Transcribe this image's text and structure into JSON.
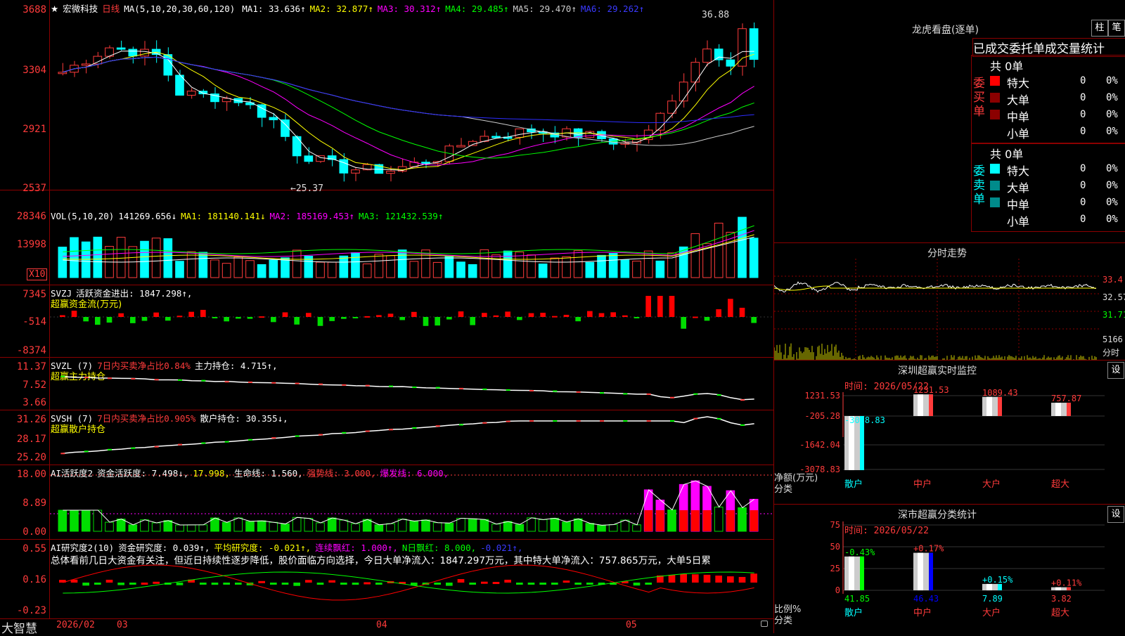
{
  "stock": {
    "name": "宏微科技",
    "period": "日线",
    "star": "★"
  },
  "main": {
    "ma_label": "MA(5,10,20,30,60,120)",
    "mas": [
      {
        "label": "MA1: 33.636↑",
        "color": "#ffffff"
      },
      {
        "label": "MA2: 32.877↑",
        "color": "#ffff00"
      },
      {
        "label": "MA3: 30.312↑",
        "color": "#ff00ff"
      },
      {
        "label": "MA4: 29.485↑",
        "color": "#00ff00"
      },
      {
        "label": "MA5: 29.470↑",
        "color": "#cccccc"
      },
      {
        "label": "MA6: 29.262↑",
        "color": "#2d2dff"
      }
    ],
    "yticks": [
      "3688",
      "3304",
      "2921",
      "2537"
    ],
    "high_label": "36.88",
    "low_label": "←25.37"
  },
  "vol": {
    "name": "VOL(5,10,20)",
    "value": "141269.656↓",
    "ma1": "MA1: 181140.141↓",
    "ma2": "MA2: 185169.453↑",
    "ma3": "MA3: 121432.539↑",
    "yticks": [
      "28346",
      "13998"
    ],
    "unit": "X10"
  },
  "svzj": {
    "name": "SVZJ",
    "t1": "活跃资金进出: 1847.298↑,",
    "t2": "超赢资金流(万元)",
    "yticks": [
      "7345",
      "-514",
      "-8374"
    ]
  },
  "svzl": {
    "name": "SVZL (7)",
    "t1": "7日内买卖净占比0.84%",
    "t2": "主力持仓: 4.715↑,",
    "t3": "超赢主力持仓",
    "yticks": [
      "11.37",
      "7.52",
      "3.66"
    ]
  },
  "svsh": {
    "name": "SVSH (7)",
    "t1": "7日内买卖净占比0.905%",
    "t2": "散户持仓: 30.355↓,",
    "t3": "超赢散户持仓",
    "yticks": [
      "31.26",
      "28.17",
      "25.20"
    ]
  },
  "ai1": {
    "name": "AI活跃度2",
    "t1": "资金活跃度: 7.498↓,",
    "t2": "17.998,",
    "t3": "生命线: 1.560,",
    "t4": "强势线: 3.000,",
    "t5": "爆发线: 6.000,",
    "yticks": [
      "18.00",
      "8.89",
      "0.00"
    ]
  },
  "ai2": {
    "name": "AI研究度2(10)",
    "t1": "资金研究度: 0.039↑,",
    "t2": "平均研究度: -0.021↑,",
    "t3": "连续飘红: 1.000↑,",
    "t4": "N日飘红: 8.000,",
    "t5": "-0.021↑,",
    "comment": "总体看前几日大资金有关注，但近日持续性逐步降低，股价面临方向选择，今日大单净流入：1847.297万元，其中特大单净流入：757.865万元，大单5日累",
    "yticks": [
      "0.55",
      "0.16",
      "-0.23"
    ]
  },
  "footer": {
    "brand": "大智慧",
    "dates": [
      "2026/02",
      "03",
      "04",
      "05"
    ]
  },
  "lhb": {
    "title": "龙虎看盘(逐单)",
    "btn1": "柱",
    "btn2": "笔",
    "tabs": "已成交委托单成交量统计",
    "buy": {
      "side": "委买单",
      "total": "共 0单",
      "rows": [
        {
          "name": "特大",
          "v": "0",
          "p": "0%",
          "c": "#ff0000"
        },
        {
          "name": "大单",
          "v": "0",
          "p": "0%",
          "c": "#8b0000"
        },
        {
          "name": "中单",
          "v": "0",
          "p": "0%",
          "c": "#8b0000"
        },
        {
          "name": "小单",
          "v": "0",
          "p": "0%",
          "c": "#000000"
        }
      ]
    },
    "sell": {
      "side": "委卖单",
      "total": "共 0单",
      "rows": [
        {
          "name": "特大",
          "v": "0",
          "p": "0%",
          "c": "#00ffff"
        },
        {
          "name": "大单",
          "v": "0",
          "p": "0%",
          "c": "#008b8b"
        },
        {
          "name": "中单",
          "v": "0",
          "p": "0%",
          "c": "#008b8b"
        },
        {
          "name": "小单",
          "v": "0",
          "p": "0%",
          "c": "#000000"
        }
      ]
    }
  },
  "intraday": {
    "title": "分时走势",
    "yticks": [
      "33.4",
      "32.57",
      "31.71"
    ],
    "vol_tick": "5166",
    "vol_label": "分时"
  },
  "sz_monitor": {
    "title": "深圳超赢实时监控",
    "btn": "设",
    "time": "时间: 2026/05/22",
    "yticks": [
      "1231.53",
      "-205.28",
      "-1642.04",
      "-3078.83"
    ],
    "ylabel": "净额(万元)",
    "xlabel": "分类",
    "bars": [
      {
        "cat": "散户",
        "value": -3078.83,
        "label": "-3078.83",
        "color": "#00ffff"
      },
      {
        "cat": "中户",
        "value": 1231.53,
        "label": "1231.53",
        "color": "#ff3b3b"
      },
      {
        "cat": "大户",
        "value": 1089.43,
        "label": "1089.43",
        "color": "#ff3b3b"
      },
      {
        "cat": "超大",
        "value": 757.87,
        "label": "757.87",
        "color": "#ff3b3b"
      }
    ]
  },
  "sz_class": {
    "title": "深市超赢分类统计",
    "btn": "设",
    "time": "时间: 2026/05/22",
    "yticks": [
      "75",
      "50",
      "25",
      "0"
    ],
    "ylabel": "比例%",
    "xlabel": "分类",
    "bars": [
      {
        "cat": "散户",
        "value": 41.85,
        "label": "41.85",
        "change": "-0.43%",
        "color": "#00ff00"
      },
      {
        "cat": "中户",
        "value": 46.43,
        "label": "46.43",
        "change": "+0.17%",
        "color": "#0000ff"
      },
      {
        "cat": "大户",
        "value": 7.89,
        "label": "7.89",
        "change": "+0.15%",
        "color": "#00ffff"
      },
      {
        "cat": "超大",
        "value": 3.82,
        "label": "3.82",
        "change": "+0.11%",
        "color": "#ff3b3b"
      }
    ]
  }
}
